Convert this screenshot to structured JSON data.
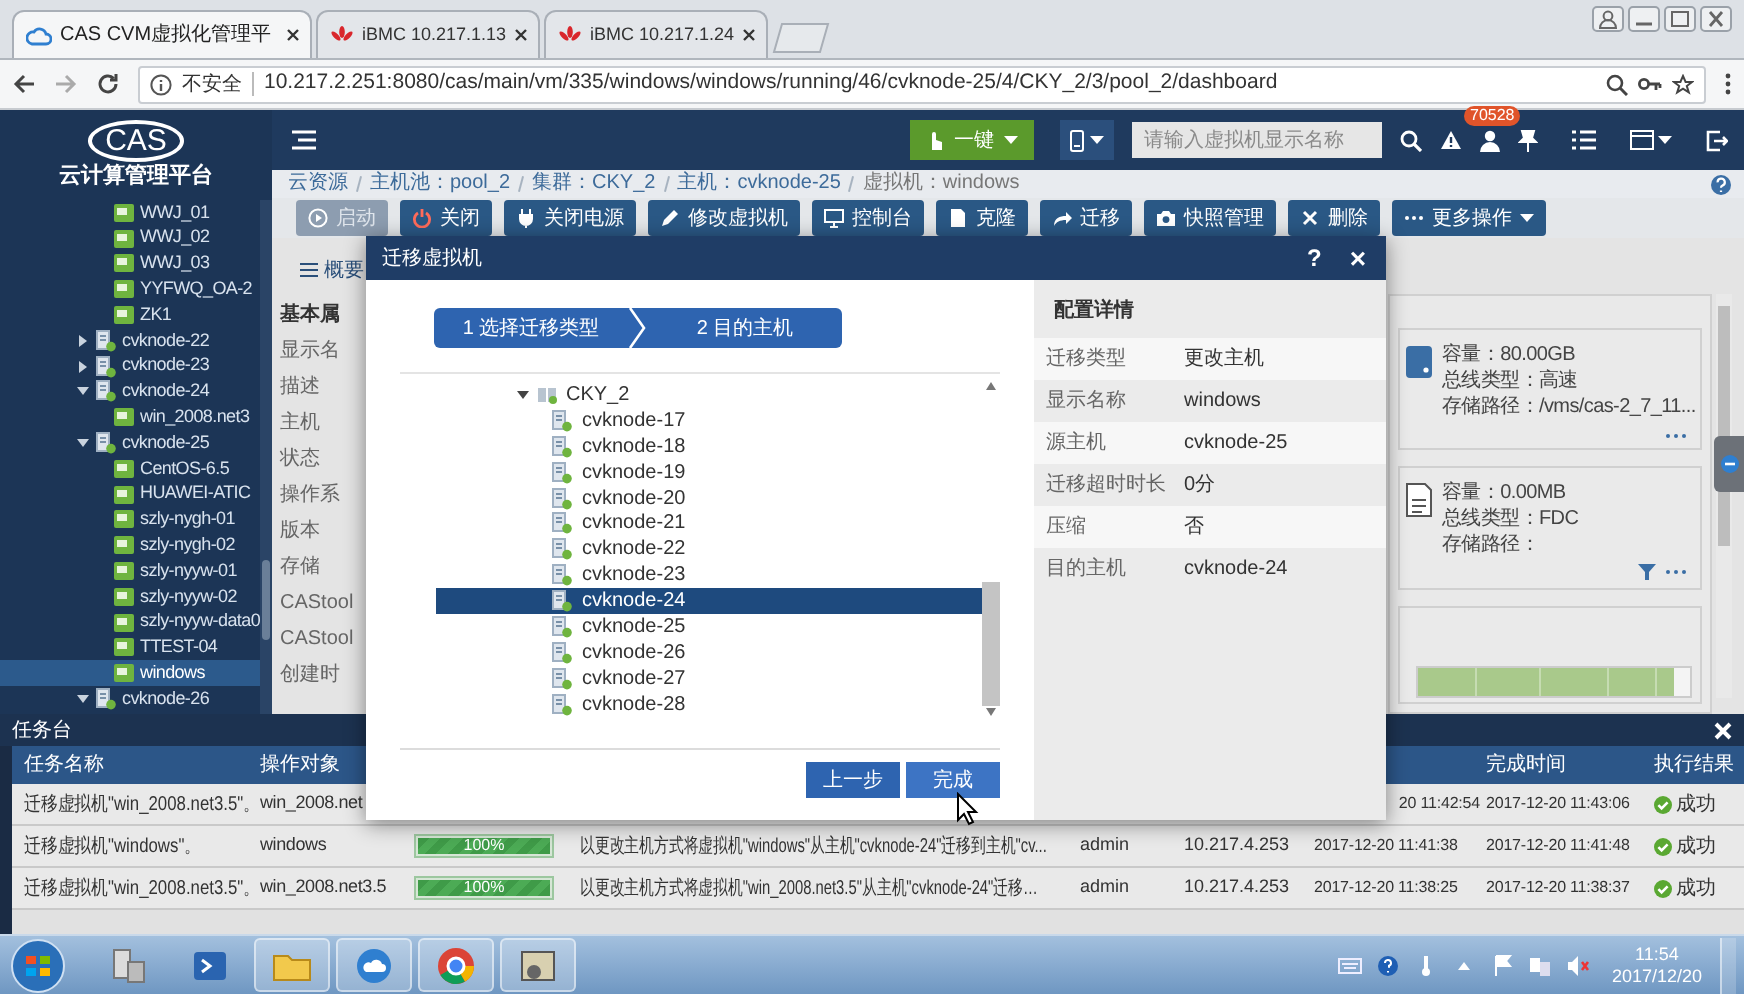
{
  "browser": {
    "tabs": [
      {
        "title": "CAS CVM虚拟化管理平",
        "selected": true
      },
      {
        "title": "iBMC 10.217.1.13",
        "selected": false
      },
      {
        "title": "iBMC 10.217.1.24",
        "selected": false
      }
    ],
    "security_label": "不安全",
    "url": "10.217.2.251:8080/cas/main/vm/335/windows/windows/running/46/cvknode-25/4/CKY_2/3/pool_2/dashboard"
  },
  "app": {
    "logo": "CAS",
    "subtitle": "云计算管理平台",
    "quick_button": "一键",
    "search": {
      "placeholder": "请输入虚拟机显示名称"
    },
    "alert_count": "70528"
  },
  "breadcrumb": [
    "云资源",
    "主机池：pool_2",
    "集群：CKY_2",
    "主机：cvknode-25",
    "虚拟机：windows"
  ],
  "toolbar": [
    {
      "label": "启动",
      "disabled": true
    },
    {
      "label": "关闭",
      "disabled": false
    },
    {
      "label": "关闭电源",
      "disabled": false
    },
    {
      "label": "修改虚拟机",
      "disabled": false
    },
    {
      "label": "控制台",
      "disabled": false
    },
    {
      "label": "克隆",
      "disabled": false
    },
    {
      "label": "迁移",
      "disabled": false
    },
    {
      "label": "快照管理",
      "disabled": false
    },
    {
      "label": "删除",
      "disabled": false
    },
    {
      "label": "更多操作",
      "disabled": false
    }
  ],
  "sidebar": {
    "tree": [
      {
        "children": [
          {
            "label": "WWJ_01",
            "kind": "vm",
            "selected": false
          },
          {
            "label": "WWJ_02",
            "kind": "vm",
            "selected": false
          },
          {
            "label": "WWJ_03",
            "kind": "vm",
            "selected": false
          },
          {
            "label": "YYFWQ_OA-2",
            "kind": "vm",
            "selected": false
          },
          {
            "label": "ZK1",
            "kind": "vm",
            "selected": false
          }
        ]
      },
      {
        "label": "cvknode-22",
        "kind": "host",
        "expanded": false,
        "selected": false
      },
      {
        "label": "cvknode-23",
        "kind": "host",
        "expanded": false,
        "selected": false
      },
      {
        "label": "cvknode-24",
        "kind": "host",
        "expanded": true,
        "selected": false,
        "children": [
          {
            "label": "win_2008.net3",
            "kind": "vm",
            "selected": false
          }
        ]
      },
      {
        "label": "cvknode-25",
        "kind": "host",
        "expanded": true,
        "selected": false,
        "children": [
          {
            "label": "CentOS-6.5",
            "kind": "vm",
            "selected": false
          },
          {
            "label": "HUAWEI-ATIC",
            "kind": "vm",
            "selected": false
          },
          {
            "label": "szly-nygh-01",
            "kind": "vm",
            "selected": false
          },
          {
            "label": "szly-nygh-02",
            "kind": "vm",
            "selected": false
          },
          {
            "label": "szly-nyyw-01",
            "kind": "vm",
            "selected": false
          },
          {
            "label": "szly-nyyw-02",
            "kind": "vm",
            "selected": false
          },
          {
            "label": "szly-nyyw-data0",
            "kind": "vm",
            "selected": false
          },
          {
            "label": "TTEST-04",
            "kind": "vm",
            "selected": false
          },
          {
            "label": "windows",
            "kind": "vm",
            "selected": true
          }
        ]
      },
      {
        "label": "cvknode-26",
        "kind": "host",
        "expanded": true,
        "selected": false
      }
    ]
  },
  "overview": {
    "tab": "概要",
    "labels": [
      "基本属",
      "显示名",
      "描述",
      "主机",
      "状态",
      "操作系",
      "版本",
      "存储",
      "CAStool",
      "CAStool",
      "创建时"
    ]
  },
  "disks": [
    {
      "kind": "disk",
      "lines": [
        "容量：80.00GB",
        "总线类型：高速",
        "存储路径：/vms/cas-2_7_11..."
      ]
    },
    {
      "kind": "floppy",
      "lines": [
        "容量：0.00MB",
        "总线类型：FDC",
        "存储路径："
      ]
    }
  ],
  "dialog": {
    "title": "迁移虚拟机",
    "help_button": "?",
    "close_button": "×",
    "steps": [
      "1 选择迁移类型",
      "2 目的主机"
    ],
    "tree": {
      "label": "CKY_2",
      "expanded": true,
      "children": [
        {
          "label": "cvknode-17",
          "selected": false
        },
        {
          "label": "cvknode-18",
          "selected": false
        },
        {
          "label": "cvknode-19",
          "selected": false
        },
        {
          "label": "cvknode-20",
          "selected": false
        },
        {
          "label": "cvknode-21",
          "selected": false
        },
        {
          "label": "cvknode-22",
          "selected": false
        },
        {
          "label": "cvknode-23",
          "selected": false
        },
        {
          "label": "cvknode-24",
          "selected": true
        },
        {
          "label": "cvknode-25",
          "selected": false
        },
        {
          "label": "cvknode-26",
          "selected": false
        },
        {
          "label": "cvknode-27",
          "selected": false
        },
        {
          "label": "cvknode-28",
          "selected": false
        }
      ]
    },
    "buttons": [
      "上一步",
      "完成"
    ],
    "details": {
      "title": "配置详情",
      "rows": [
        {
          "label": "迁移类型",
          "value": "更改主机"
        },
        {
          "label": "显示名称",
          "value": "windows"
        },
        {
          "label": "源主机",
          "value": "cvknode-25"
        },
        {
          "label": "迁移超时时长",
          "value": "0分"
        },
        {
          "label": "压缩",
          "value": "否"
        },
        {
          "label": "目的主机",
          "value": "cvknode-24"
        }
      ]
    }
  },
  "tasks": {
    "title": "任务台",
    "columns": {
      "name": "任务名称",
      "object": "操作对象",
      "end": "完成时间",
      "result": "执行结果"
    },
    "rows": [
      {
        "name": "迁移虚拟机\"win_2008.net3.5\"。",
        "object": "win_2008.net",
        "start": "20 11:42:54",
        "end": "2017-12-20 11:43:06",
        "result": "成功",
        "succeeded": true
      },
      {
        "name": "迁移虚拟机\"windows\"。",
        "object": "windows",
        "progress": {
          "level": 1,
          "label": "100%"
        },
        "description": "以更改主机方式将虚拟机\"windows\"从主机\"cvknode-24\"迁移到主机\"cv...",
        "user": "admin",
        "ip": "10.217.4.253",
        "start": "2017-12-20 11:41:38",
        "end": "2017-12-20 11:41:48",
        "result": "成功",
        "succeeded": true
      },
      {
        "name": "迁移虚拟机\"win_2008.net3.5\"。",
        "object": "win_2008.net3.5",
        "progress": {
          "level": 1,
          "label": "100%"
        },
        "description": "以更改主机方式将虚拟机\"win_2008.net3.5\"从主机\"cvknode-24\"迁移…",
        "user": "admin",
        "ip": "10.217.4.253",
        "start": "2017-12-20 11:38:25",
        "end": "2017-12-20 11:38:37",
        "result": "成功",
        "succeeded": true
      }
    ]
  },
  "taskbar": {
    "apps": [
      {
        "running": false
      },
      {
        "running": false
      },
      {
        "running": true
      },
      {
        "running": true
      },
      {
        "running": true
      },
      {
        "running": true
      }
    ],
    "time": "11:54",
    "date": "2017/12/20"
  }
}
